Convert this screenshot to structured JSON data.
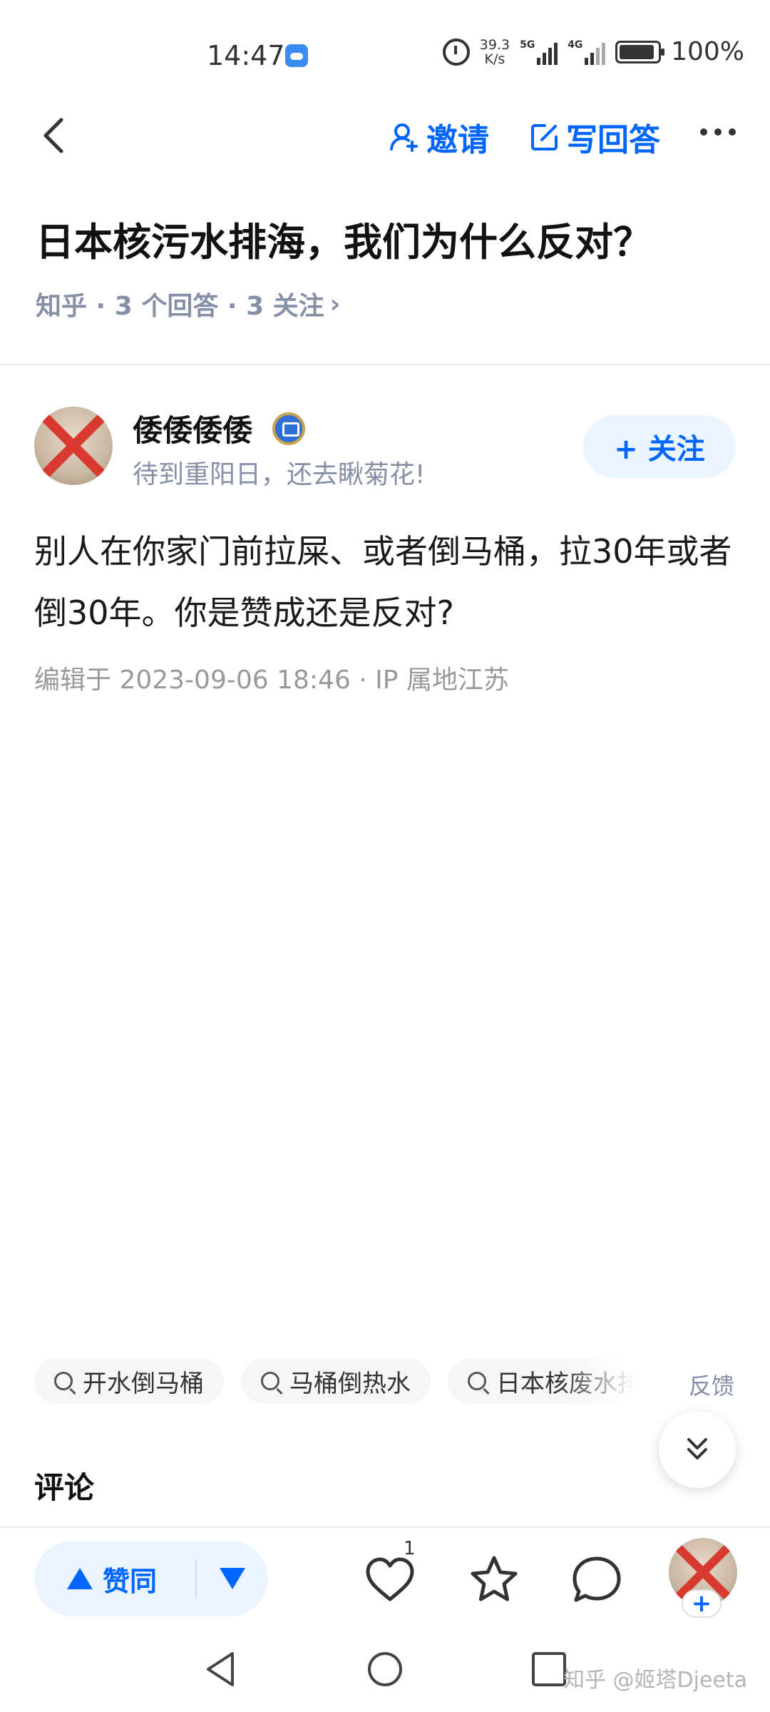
{
  "status_bar": {
    "time": "14:47",
    "net_speed_value": "39.3",
    "net_speed_unit": "K/s",
    "signal1_tag": "5G",
    "signal2_tag": "4G",
    "battery": "100%"
  },
  "nav": {
    "invite_label": "邀请",
    "write_answer_label": "写回答"
  },
  "question": {
    "title": "日本核污水排海，我们为什么反对？",
    "meta": "知乎 · 3 个回答 · 3 关注",
    "meta_chevron": "›"
  },
  "author": {
    "name": "倭倭倭倭",
    "bio": "待到重阳日，还去瞅菊花!",
    "follow_label": "+ 关注"
  },
  "answer": {
    "text": "别人在你家门前拉屎、或者倒马桶，拉30年或者倒30年。你是赞成还是反对?",
    "edit_meta": "编辑于 2023-09-06 18:46 · IP 属地江苏"
  },
  "related_searches": [
    "开水倒马桶",
    "马桶倒热水",
    "日本核废水排"
  ],
  "feedback_label": "反馈",
  "comments_heading": "评论",
  "action_bar": {
    "upvote_label": "赞同",
    "like_count": "1"
  },
  "watermark": "知乎 @姬塔Djeeta",
  "colors": {
    "brand_blue": "#0066ff",
    "meta_gray": "#8590a6"
  }
}
